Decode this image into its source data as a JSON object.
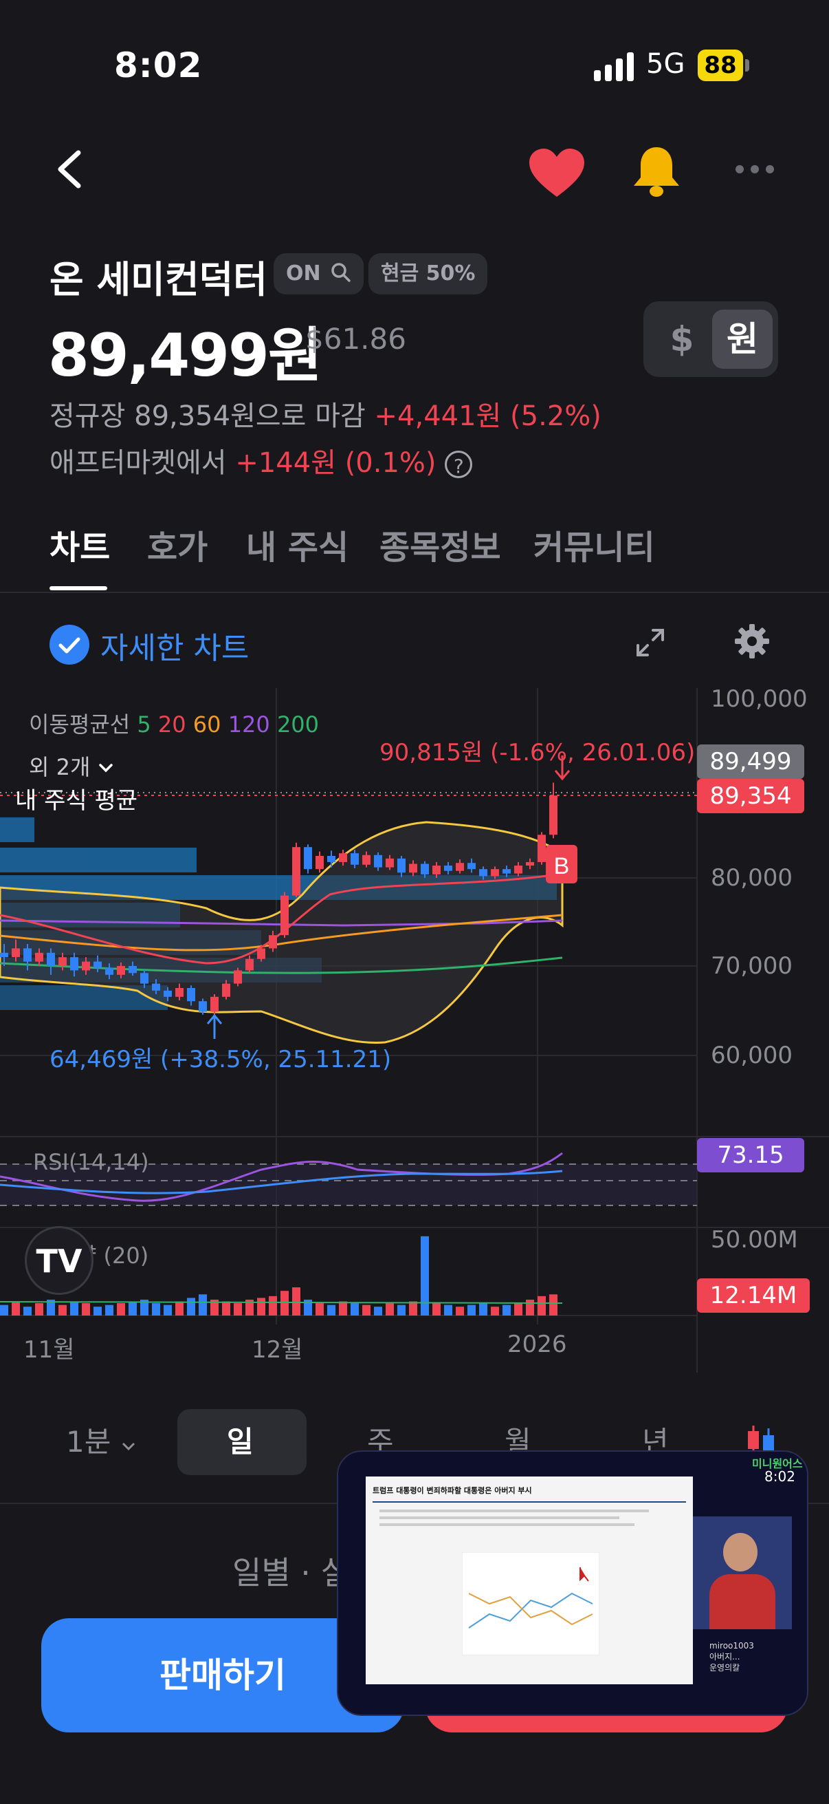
{
  "status_bar": {
    "time": "8:02",
    "network": "5G",
    "battery": "88"
  },
  "header": {
    "back_icon": "chevron-left-icon",
    "favorite_icon": "heart-icon",
    "alert_icon": "bell-icon",
    "more_icon": "more-horizontal-icon",
    "favorite_color": "#f04452",
    "alert_color": "#f5b400"
  },
  "stock": {
    "name": "온 세미컨덕터",
    "search_chip": "ON",
    "cash_chip": "현금 50%",
    "price": "89,499원",
    "usd_price": "$61.86",
    "currency_options": [
      "$",
      "원"
    ],
    "close_text": "정규장 89,354원으로 마감",
    "close_change": "+4,441원 (5.2%)",
    "after_text": "애프터마켓에서",
    "after_change": "+144원 (0.1%)",
    "help": "?"
  },
  "tabs": [
    "차트",
    "호가",
    "내 주식",
    "종목정보",
    "커뮤니티"
  ],
  "detail": {
    "label": "자세한 차트"
  },
  "chart_data": {
    "type": "candlestick",
    "moving_average_label": "이동평균선",
    "moving_averages": [
      {
        "name": "5",
        "color": "#2fb36b"
      },
      {
        "name": "20",
        "color": "#f04452"
      },
      {
        "name": "60",
        "color": "#f59b23"
      },
      {
        "name": "120",
        "color": "#9b55e0"
      },
      {
        "name": "200",
        "color": "#2fb36b"
      }
    ],
    "others_label": "외 2개",
    "avg_line_label": "내 주식 평균",
    "high_annotation": "90,815원 (-1.6%, 26.01.06)",
    "low_annotation": "64,469원 (+38.5%, 25.11.21)",
    "y_ticks": [
      "100,000",
      "80,000",
      "70,000",
      "60,000"
    ],
    "ylim": [
      55000,
      100000
    ],
    "current_price_tag": "89,499",
    "close_price_tag": "89,354",
    "marker": "B",
    "rsi": {
      "label": "RSI(14,14)",
      "value_tag": "73.15"
    },
    "volume": {
      "label": "거래량 (20)",
      "axis_max": "50.00M",
      "value_tag": "12.14M"
    },
    "x_ticks": [
      "11월",
      "12월",
      "2026"
    ],
    "candles": [
      [
        71500,
        71000,
        72500,
        70000
      ],
      [
        71000,
        72000,
        73000,
        70500
      ],
      [
        72000,
        70500,
        72500,
        69500
      ],
      [
        70500,
        71500,
        72000,
        70000
      ],
      [
        71500,
        70000,
        72000,
        69000
      ],
      [
        70000,
        71000,
        71500,
        69500
      ],
      [
        71000,
        69500,
        71500,
        68800
      ],
      [
        69500,
        70500,
        71000,
        69000
      ],
      [
        70500,
        69800,
        71200,
        69300
      ],
      [
        69800,
        69000,
        70300,
        68500
      ],
      [
        69000,
        70000,
        70400,
        68600
      ],
      [
        70000,
        69200,
        70500,
        68900
      ],
      [
        69200,
        68000,
        69600,
        67500
      ],
      [
        68000,
        67200,
        68500,
        66800
      ],
      [
        67200,
        66500,
        67600,
        66000
      ],
      [
        66500,
        67500,
        68000,
        66100
      ],
      [
        67500,
        66000,
        67800,
        65500
      ],
      [
        66000,
        64800,
        66300,
        64469
      ],
      [
        64800,
        66500,
        66800,
        64500
      ],
      [
        66500,
        68000,
        68400,
        66200
      ],
      [
        68000,
        69500,
        69800,
        67700
      ],
      [
        69500,
        70800,
        71200,
        69200
      ],
      [
        70800,
        72000,
        72400,
        70500
      ],
      [
        72000,
        73500,
        74000,
        71600
      ],
      [
        73500,
        78000,
        78400,
        73200
      ],
      [
        78000,
        83500,
        84000,
        77800
      ],
      [
        83500,
        81000,
        83800,
        80500
      ],
      [
        81000,
        82500,
        83000,
        80600
      ],
      [
        82500,
        81800,
        83100,
        81200
      ],
      [
        81800,
        82800,
        83200,
        81400
      ],
      [
        82800,
        81500,
        83200,
        81100
      ],
      [
        81500,
        82600,
        83000,
        81200
      ],
      [
        82600,
        81200,
        82900,
        80800
      ],
      [
        81200,
        82200,
        82600,
        80900
      ],
      [
        82200,
        80600,
        82500,
        80100
      ],
      [
        80600,
        81600,
        82000,
        80200
      ],
      [
        81600,
        80400,
        81900,
        80000
      ],
      [
        80400,
        81400,
        81800,
        80000
      ],
      [
        81400,
        80800,
        81800,
        80400
      ],
      [
        80800,
        81700,
        82100,
        80500
      ],
      [
        81700,
        81000,
        82200,
        80600
      ],
      [
        81000,
        80200,
        81300,
        79800
      ],
      [
        80200,
        81000,
        81300,
        79900
      ],
      [
        81000,
        80500,
        81400,
        80100
      ],
      [
        80500,
        81400,
        81800,
        80200
      ],
      [
        81400,
        81800,
        82200,
        81000
      ],
      [
        81800,
        84900,
        85200,
        81500
      ],
      [
        84900,
        89354,
        90815,
        84500
      ]
    ],
    "volumes": [
      6,
      8,
      5,
      7,
      9,
      6,
      8,
      7,
      5,
      6,
      7,
      8,
      9,
      7,
      6,
      8,
      10,
      12,
      9,
      8,
      7,
      9,
      10,
      11,
      14,
      16,
      9,
      7,
      6,
      8,
      7,
      6,
      5,
      7,
      6,
      8,
      45,
      7,
      6,
      5,
      6,
      7,
      5,
      6,
      7,
      9,
      11,
      12
    ],
    "up_color": "#f04452",
    "down_color": "#3182f6"
  },
  "periods": {
    "options": [
      "1분",
      "일",
      "주",
      "월",
      "년"
    ],
    "selected": "일"
  },
  "daily_line": "일별 · 실",
  "actions": {
    "sell": "판매하기",
    "buy": ""
  },
  "pip_overlay": {
    "brand": "미니원어스",
    "time": "8:02",
    "headline": "트럼프 대통령이 변죄하파할 대통령은 아버지 부시",
    "chat": [
      "miroo1003",
      "아버지...",
      "운영의칼"
    ]
  }
}
